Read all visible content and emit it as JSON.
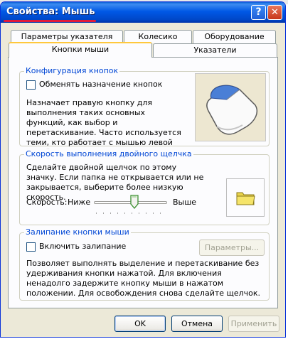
{
  "window": {
    "title": "Свойства: Мышь",
    "help_glyph": "?",
    "close_glyph": "✕"
  },
  "tabs": [
    {
      "label": "Параметры указателя"
    },
    {
      "label": "Колесико"
    },
    {
      "label": "Оборудование"
    },
    {
      "label": "Кнопки мыши",
      "selected": true
    },
    {
      "label": "Указатели"
    }
  ],
  "buttons_config": {
    "title": "Конфигурация кнопок",
    "swap_label": "Обменять назначение кнопок",
    "swap_checked": false,
    "description": "Назначает правую кнопку для выполнения таких основных функций, как выбор и перетаскивание. Часто используется теми, кто работает с мышью левой рукой.",
    "image_icon": "mouse-icon"
  },
  "double_click": {
    "title": "Скорость выполнения двойного щелчка",
    "description": "Сделайте двойной щелчок по этому значку. Если папка не открывается или не закрывается, выберите более низкую скорость.",
    "speed_label": "Скорость:",
    "low_label": "Ниже",
    "high_label": "Выше",
    "slider_value": 0.55,
    "test_icon": "folder-icon"
  },
  "click_lock": {
    "title": "Залипание кнопки мыши",
    "enable_label": "Включить залипание",
    "enable_checked": false,
    "settings_button": "Параметры...",
    "description": "Позволяет выполнять выделение и перетаскивание без удерживания кнопки нажатой. Для включения ненадолго задержите кнопку мыши в нажатом положении. Для освобождения снова сделайте щелчок."
  },
  "footer": {
    "ok": "OK",
    "cancel": "Отмена",
    "apply": "Применить"
  },
  "annotation": {
    "color": "#e5157a",
    "underline_color": "#e01a3a"
  }
}
